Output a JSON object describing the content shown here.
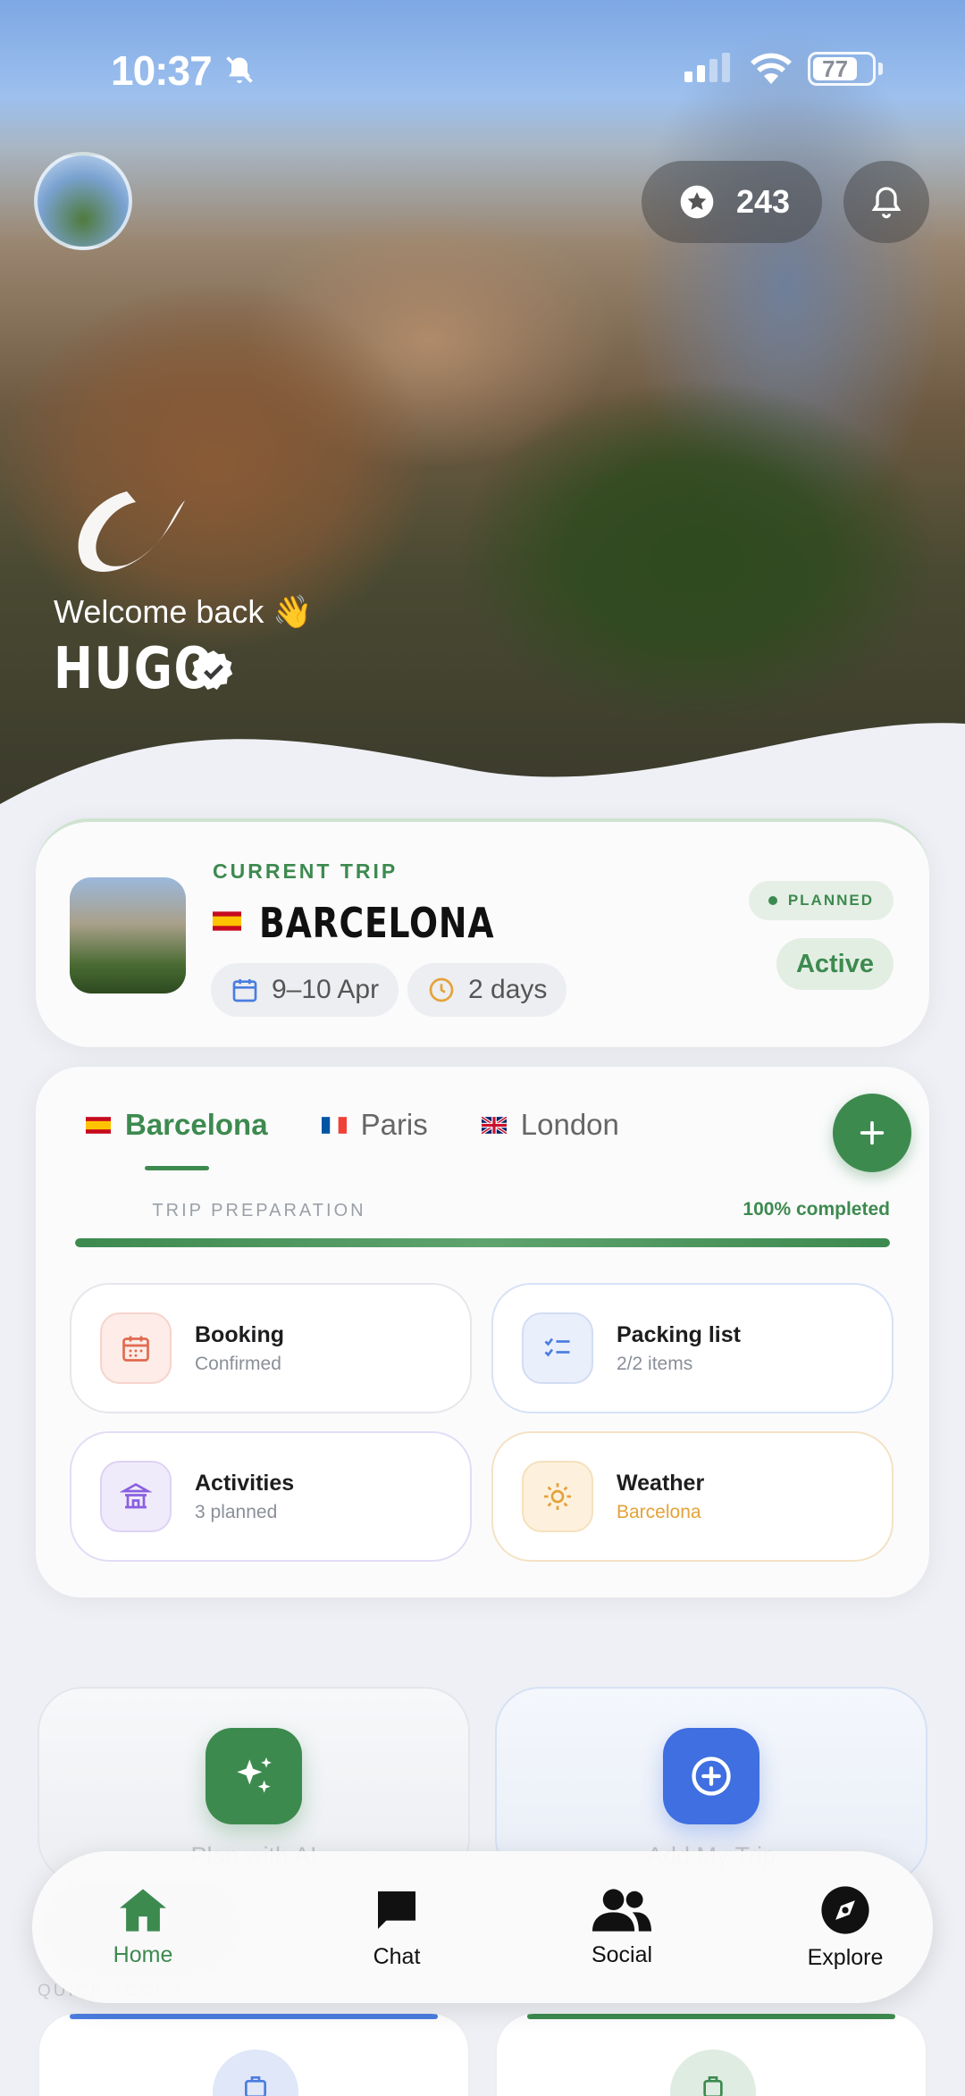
{
  "status_bar": {
    "time": "10:37",
    "battery": "77"
  },
  "header": {
    "points": "243"
  },
  "hero": {
    "welcome": "Welcome back 👋",
    "username": "HUGO"
  },
  "current_trip": {
    "label": "CURRENT TRIP",
    "city": "BARCELONA",
    "dates": "9–10 Apr",
    "duration": "2 days",
    "status_badge": "PLANNED",
    "active_label": "Active"
  },
  "trip_tabs": [
    {
      "label": "Barcelona",
      "flag": "spain-flag"
    },
    {
      "label": "Paris",
      "flag": "france-flag"
    },
    {
      "label": "London",
      "flag": "uk-flag"
    }
  ],
  "preparation": {
    "title": "TRIP PREPARATION",
    "completed_label": "100% completed",
    "progress": 1.0
  },
  "tiles": {
    "booking": {
      "title": "Booking",
      "subtitle": "Confirmed",
      "icon": "calendar-icon"
    },
    "packing": {
      "title": "Packing list",
      "subtitle": "2/2 items",
      "icon": "checklist-icon"
    },
    "activities": {
      "title": "Activities",
      "subtitle": "3 planned",
      "icon": "temple-icon"
    },
    "weather": {
      "title": "Weather",
      "subtitle": "Barcelona",
      "icon": "sun-icon"
    }
  },
  "actions": {
    "plan_ai": "Plan with AI",
    "add_trip": "Add My Trip"
  },
  "quick_access": {
    "label": "QUICK ACCESS"
  },
  "nav": {
    "home": "Home",
    "chat": "Chat",
    "social": "Social",
    "explore": "Explore"
  },
  "colors": {
    "accent": "#3d8a4f",
    "blue": "#4a7de0"
  }
}
